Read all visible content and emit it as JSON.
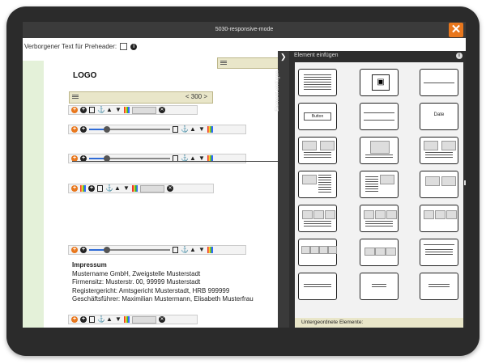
{
  "window": {
    "title": "5030-responsive-mode",
    "close_label": "✕"
  },
  "preheader": {
    "label": "Verborgener Text für Preheader:"
  },
  "canvas": {
    "logo": "LOGO",
    "width_value": "< 300 >",
    "impressum": {
      "title": "Impressum",
      "lines": [
        "Mustername GmbH, Zweigstelle Musterstadt",
        "Firmensitz: Musterstr. 00, 99999 Musterstadt",
        "Registergericht: Amtsgericht Musterstadt, HRB 999999",
        "Geschäftsführer: Maximilian Mustermann, Elisabeth Musterfrau"
      ]
    }
  },
  "panel": {
    "sidetab_label": "Element einfügen",
    "title": "Element einfügen",
    "tiles": {
      "button": "Button",
      "date": "Date"
    },
    "footer": "Untergeordnete Elemente:"
  },
  "colors": {
    "accent": "#e8771d",
    "panel_bg": "#2e2e2e",
    "handle_bg": "#e9e6c9",
    "green_strip": "#e4f1d9"
  },
  "icons": [
    "plus-orange-icon",
    "plus-icon",
    "copy-icon",
    "anchor-icon",
    "arrow-up-icon",
    "arrow-down-icon",
    "color-icon",
    "close-icon",
    "info-icon",
    "chevron-right-icon",
    "drag-handle-icon"
  ]
}
